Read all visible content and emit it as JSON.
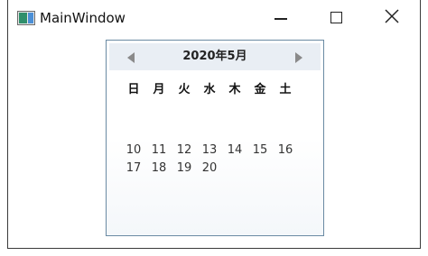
{
  "window": {
    "title": "MainWindow",
    "icon": "app-window-icon",
    "controls": {
      "minimize": "minimize-icon",
      "maximize": "maximize-icon",
      "close": "close-icon"
    }
  },
  "calendar": {
    "month_label": "2020年5月",
    "prev_icon": "triangle-left-icon",
    "next_icon": "triangle-right-icon",
    "weekdays": [
      "日",
      "月",
      "火",
      "水",
      "木",
      "金",
      "土"
    ],
    "weeks": [
      [
        "10",
        "11",
        "12",
        "13",
        "14",
        "15",
        "16"
      ],
      [
        "17",
        "18",
        "19",
        "20"
      ]
    ]
  }
}
